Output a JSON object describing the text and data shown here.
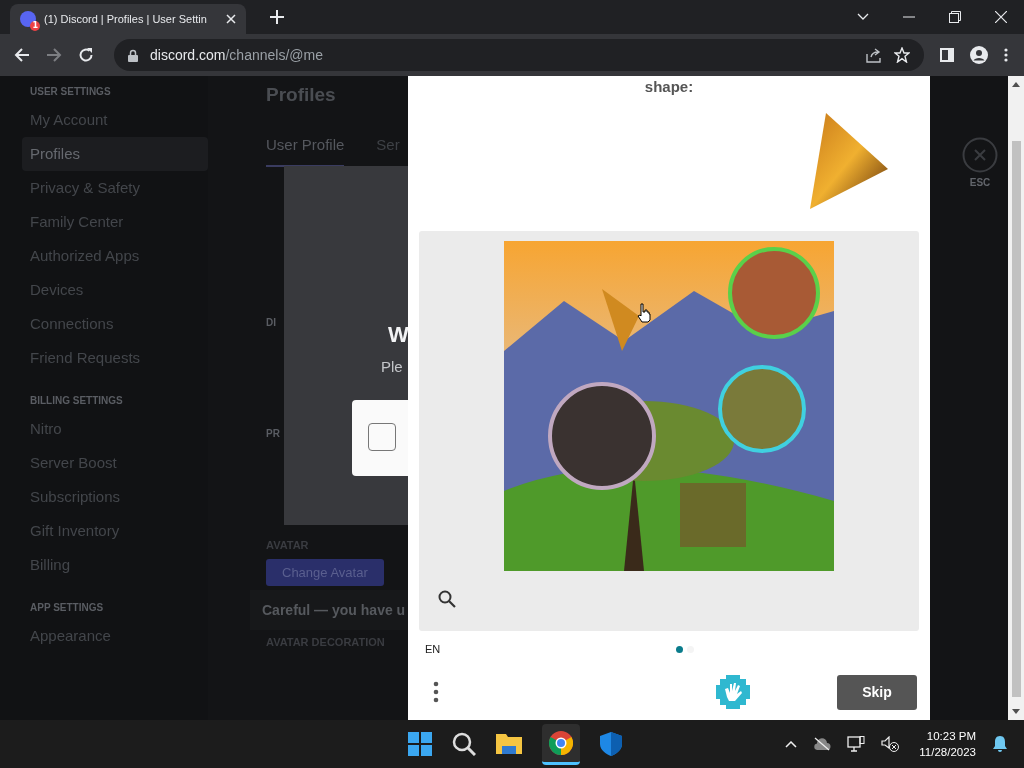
{
  "browser": {
    "tab": {
      "title": "(1) Discord | Profiles | User Settin",
      "badge": "1"
    },
    "url": {
      "host": "discord.com",
      "path": "/channels/@me"
    }
  },
  "sidebar": {
    "sections": [
      {
        "heading": "USER SETTINGS",
        "items": [
          {
            "label": "My Account",
            "selected": false
          },
          {
            "label": "Profiles",
            "selected": true
          },
          {
            "label": "Privacy & Safety",
            "selected": false
          },
          {
            "label": "Family Center",
            "selected": false
          },
          {
            "label": "Authorized Apps",
            "selected": false
          },
          {
            "label": "Devices",
            "selected": false
          },
          {
            "label": "Connections",
            "selected": false
          },
          {
            "label": "Friend Requests",
            "selected": false
          }
        ]
      },
      {
        "heading": "BILLING SETTINGS",
        "items": [
          {
            "label": "Nitro",
            "selected": false
          },
          {
            "label": "Server Boost",
            "selected": false
          },
          {
            "label": "Subscriptions",
            "selected": false
          },
          {
            "label": "Gift Inventory",
            "selected": false
          },
          {
            "label": "Billing",
            "selected": false
          }
        ]
      },
      {
        "heading": "APP SETTINGS",
        "items": [
          {
            "label": "Appearance",
            "selected": false
          }
        ]
      }
    ]
  },
  "settings": {
    "title": "Profiles",
    "tabs": [
      {
        "label": "User Profile",
        "selected": true
      },
      {
        "label": "Ser",
        "selected": false
      }
    ],
    "section_1": "DI",
    "section_2": "PR",
    "avatar_label": "AVATAR",
    "change_avatar": "Change Avatar",
    "toast": "Careful — you have u",
    "avatar_decoration_label": "AVATAR DECORATION",
    "close_label": "ESC"
  },
  "verify_modal": {
    "heading": "W",
    "text": "Ple",
    "checkbox": {
      "checked": false
    }
  },
  "captcha": {
    "prompt": "shape:",
    "language": "EN",
    "pages": [
      {
        "selected": true
      },
      {
        "selected": false
      }
    ],
    "skip": "Skip"
  },
  "taskbar": {
    "time": "10:23 PM",
    "date": "11/28/2023"
  }
}
